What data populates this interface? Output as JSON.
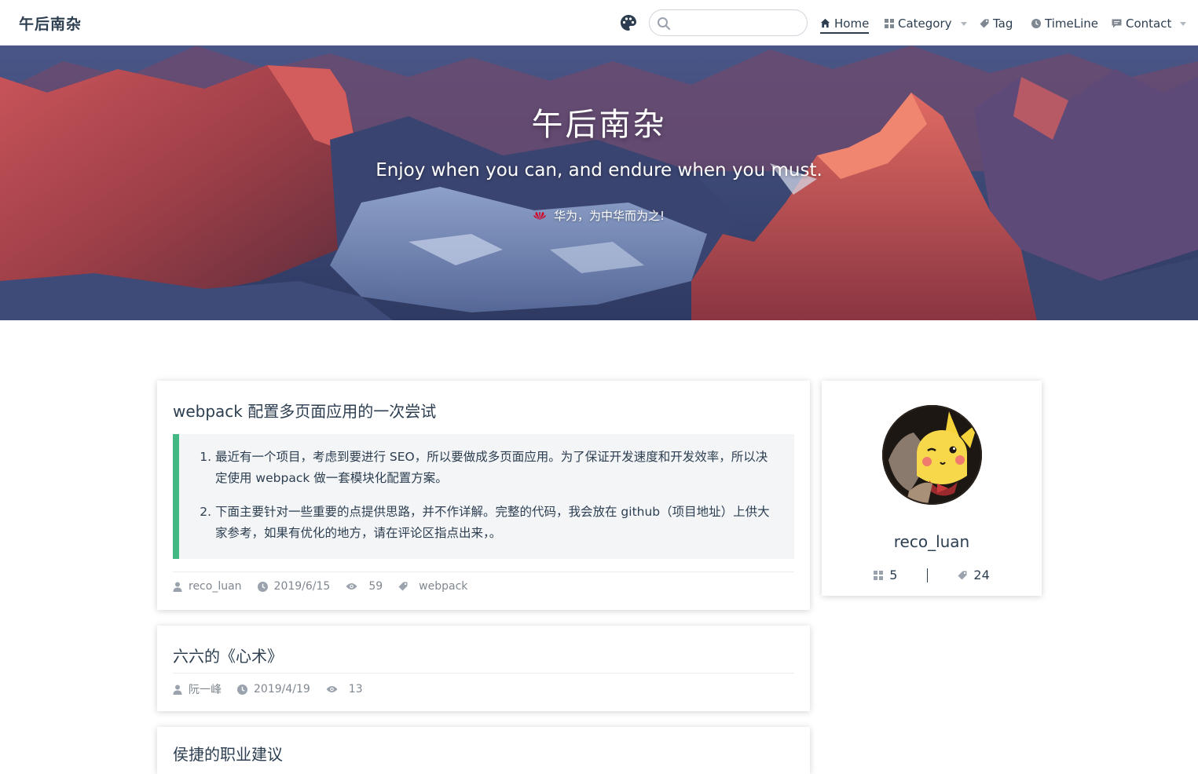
{
  "site": {
    "name": "午后南杂"
  },
  "search": {
    "placeholder": "",
    "value": ""
  },
  "nav": {
    "home": "Home",
    "category": "Category",
    "tag": "Tag",
    "timeline": "TimeLine",
    "contact": "Contact"
  },
  "hero": {
    "title": "午后南杂",
    "subtitle": "Enjoy when you can, and endure when you must.",
    "slogan": "华为，为中华而为之!"
  },
  "posts": [
    {
      "title": "webpack 配置多页面应用的一次尝试",
      "abstract": [
        "最近有一个项目，考虑到要进行 SEO，所以要做成多页面应用。为了保证开发速度和开发效率，所以决定使用 webpack 做一套模块化配置方案。",
        "下面主要针对一些重要的点提供思路，并不作详解。完整的代码，我会放在 github（项目地址）上供大家参考，如果有优化的地方，请在评论区指点出来，。"
      ],
      "author": "reco_luan",
      "date": "2019/6/15",
      "views": "59",
      "tag": "webpack"
    },
    {
      "title": "六六的《心术》",
      "author": "阮一峰",
      "date": "2019/4/19",
      "views": "13"
    },
    {
      "title": "侯捷的职业建议"
    }
  ],
  "profile": {
    "name": "reco_luan",
    "categories": "5",
    "tags": "24"
  },
  "colors": {
    "accent": "#42b983",
    "text": "#2c3e50",
    "meta": "#7f8790",
    "huawei": "#cf0a2c"
  },
  "icons": {
    "theme": "palette-icon",
    "search": "search-icon",
    "home": "home-icon",
    "category": "grid-icon",
    "tag": "tag-icon",
    "timeline": "clock-icon",
    "contact": "message-icon",
    "author": "user-icon",
    "date": "clock-icon",
    "views": "eye-icon",
    "huawei": "huawei-logo-icon"
  }
}
